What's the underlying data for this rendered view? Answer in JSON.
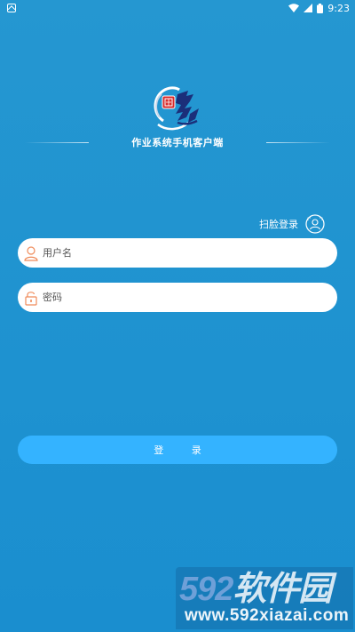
{
  "status_bar": {
    "time": "9:23",
    "notification_icon": "notification-icon",
    "wifi_icon": "wifi-icon",
    "signal_icon": "signal-icon",
    "battery_icon": "battery-icon"
  },
  "header": {
    "logo_icon": "app-logo",
    "subtitle": "作业系统手机客户端"
  },
  "face_login": {
    "label": "扫脸登录",
    "icon": "face-scan-icon"
  },
  "form": {
    "username": {
      "placeholder": "用户名",
      "value": "",
      "icon": "user-icon"
    },
    "password": {
      "placeholder": "密码",
      "value": "",
      "icon": "lock-icon"
    }
  },
  "login_button": {
    "label": "登 录"
  },
  "watermark": {
    "brand_digits": "592",
    "brand_text": "软件园",
    "url": "www.592xiazai.com"
  },
  "colors": {
    "background": "#1f93d0",
    "button": "#34b3ff",
    "icon_orange": "#ef8b5a",
    "input_bg": "#ffffff"
  }
}
